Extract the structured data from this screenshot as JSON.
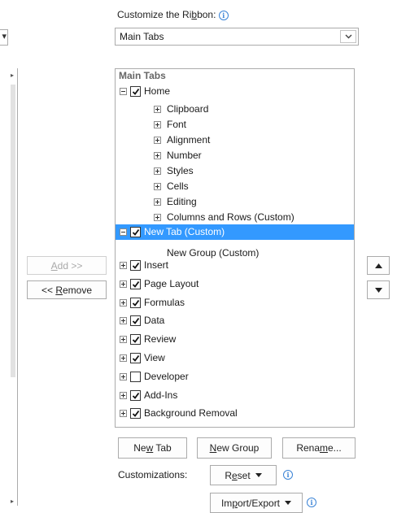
{
  "header": {
    "label_pre": "Customize the Ri",
    "label_u": "b",
    "label_post": "bon:"
  },
  "select": {
    "value": "Main Tabs"
  },
  "tree": {
    "heading": "Main Tabs",
    "home": "Home",
    "home_groups": [
      "Clipboard",
      "Font",
      "Alignment",
      "Number",
      "Styles",
      "Cells",
      "Editing",
      "Columns and Rows (Custom)"
    ],
    "new_tab": "New Tab (Custom)",
    "new_group": "New Group (Custom)",
    "tabs": [
      {
        "label": "Insert",
        "checked": true
      },
      {
        "label": "Page Layout",
        "checked": true
      },
      {
        "label": "Formulas",
        "checked": true
      },
      {
        "label": "Data",
        "checked": true
      },
      {
        "label": "Review",
        "checked": true
      },
      {
        "label": "View",
        "checked": true
      },
      {
        "label": "Developer",
        "checked": false
      },
      {
        "label": "Add-Ins",
        "checked": true
      },
      {
        "label": "Background Removal",
        "checked": true
      }
    ]
  },
  "buttons": {
    "add": {
      "u": "A",
      "post": "dd >>"
    },
    "remove": {
      "pre": "<< ",
      "u": "R",
      "post": "emove"
    },
    "new_tab": {
      "pre": "Ne",
      "u": "w",
      "post": " Tab"
    },
    "new_group": {
      "u": "N",
      "post": "ew Group"
    },
    "rename": {
      "pre": "Rena",
      "u": "m",
      "post": "e..."
    },
    "reset": {
      "pre": "R",
      "u": "e",
      "post": "set"
    },
    "import_export": {
      "pre": "Im",
      "u": "p",
      "post": "ort/Export"
    }
  },
  "customizations_label": "Customizations:",
  "colors": {
    "selection": "#3399ff",
    "info": "#3a83d6",
    "border": "#ababab"
  }
}
